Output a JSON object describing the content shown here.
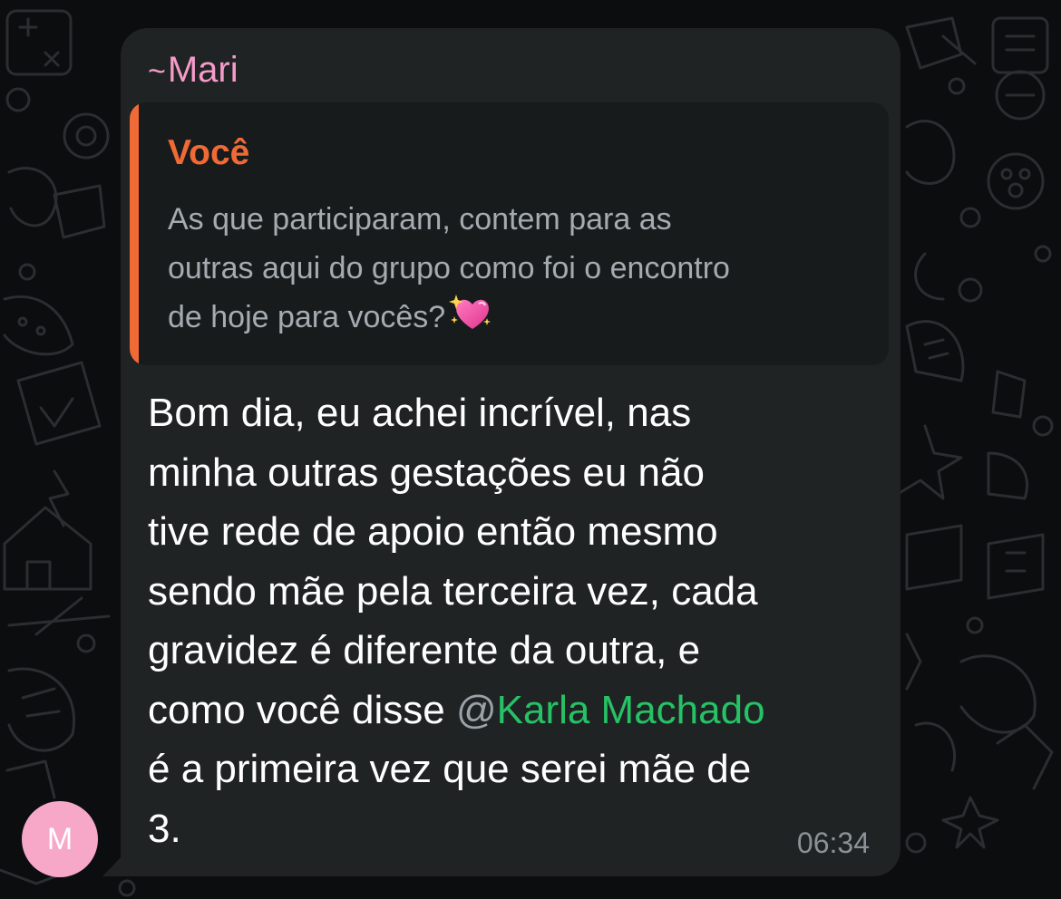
{
  "theme": {
    "wallpaper_color": "#0b0d0e",
    "bubble_color": "#1f2324",
    "sender_color": "#f59bc8",
    "quote_accent": "#f06a35",
    "mention_color": "#26c265",
    "avatar_color": "#f7a8c8"
  },
  "message": {
    "sender_prefix": "~",
    "sender_name": "Mari",
    "avatar_initial": "M",
    "time": "06:34",
    "quoted": {
      "author": "Você",
      "lines": [
        "As que participaram, contem para as",
        "outras aqui do grupo como foi o encontro",
        "de hoje para vocês?"
      ],
      "emoji": "sparkling-heart-icon"
    },
    "body_lines": [
      "Bom dia, eu achei incrível, nas",
      "minha outras gestações eu não",
      "tive rede de apoio então mesmo",
      "sendo mãe pela terceira vez, cada",
      "gravidez é diferente da outra, e",
      "como você disse ",
      "é a primeira vez que serei mãe de",
      "3."
    ],
    "mention": {
      "at": "@",
      "name": "Karla Machado"
    }
  }
}
